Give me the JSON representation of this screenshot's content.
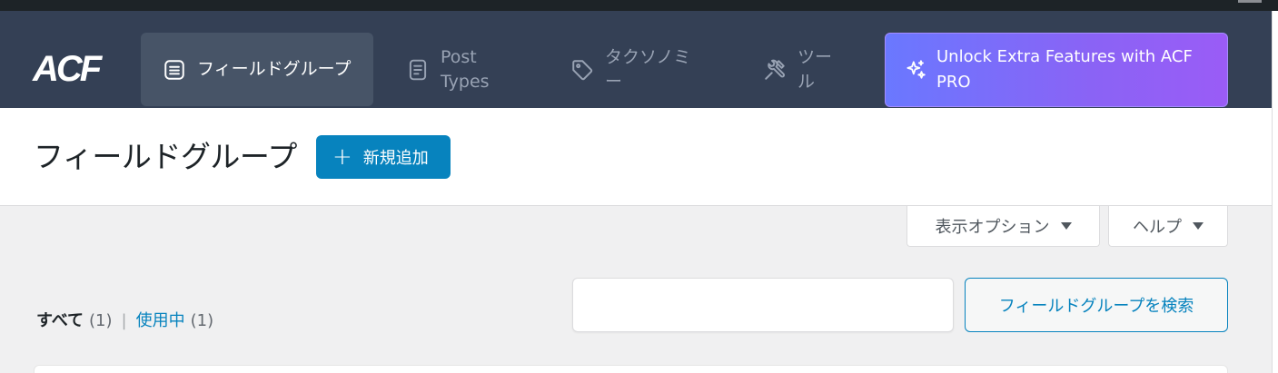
{
  "header": {
    "logo_text": "ACF",
    "tabs": [
      {
        "label": "フィールドグループ",
        "icon": "list-icon",
        "active": true
      },
      {
        "label": "Post Types",
        "icon": "document-icon",
        "active": false
      },
      {
        "label": "タクソノミー",
        "icon": "tag-icon",
        "active": false
      },
      {
        "label": "ツール",
        "icon": "wrench-screwdriver-icon",
        "active": false
      }
    ],
    "upgrade_label": "Unlock Extra Features with ACF PRO",
    "upgrade_icon": "sparkles-icon"
  },
  "title_bar": {
    "title": "フィールドグループ",
    "add_new_label": "新規追加",
    "add_new_icon": "plus-icon"
  },
  "screen_meta": {
    "screen_options_label": "表示オプション",
    "help_label": "ヘルプ"
  },
  "filters": {
    "all_label": "すべて",
    "all_count": "(1)",
    "separator": "|",
    "active_label": "使用中",
    "active_count": "(1)"
  },
  "search": {
    "input_value": "",
    "button_label": "フィールドグループを検索"
  },
  "colors": {
    "header_bg": "#344055",
    "active_tab_bg": "#475467",
    "primary": "#0783be",
    "upgrade_gradient_start": "#6a78ff",
    "upgrade_gradient_end": "#9a5cf6"
  }
}
